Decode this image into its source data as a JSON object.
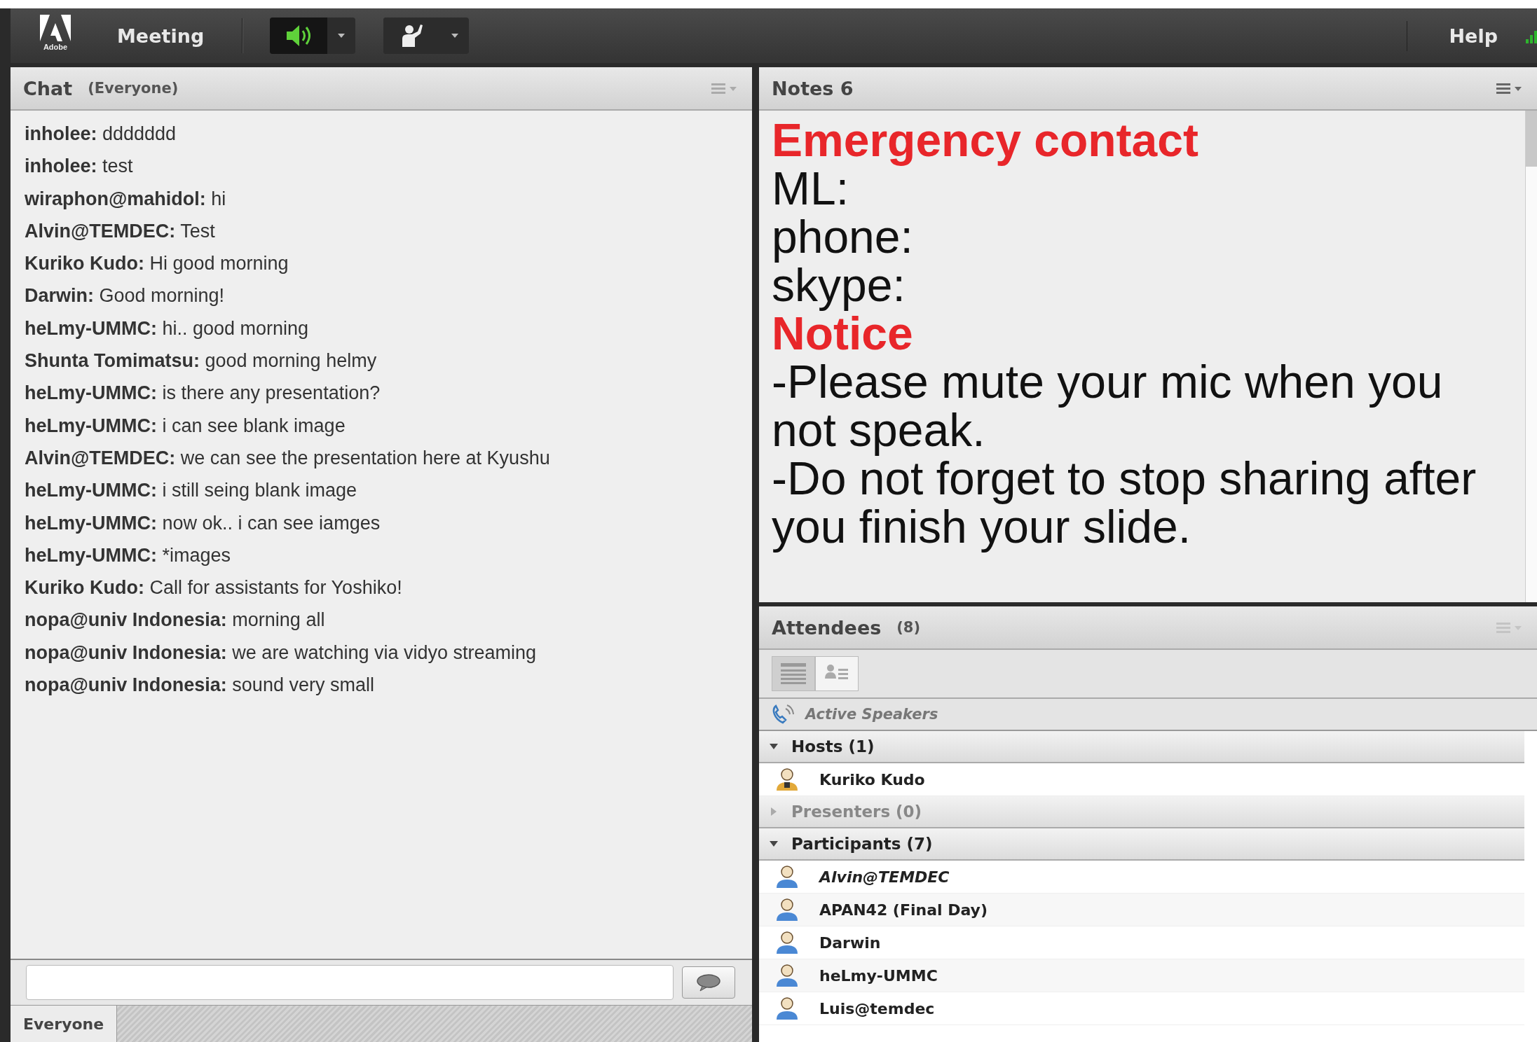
{
  "app_bar": {
    "logo_caption": "Adobe",
    "menu": "Meeting",
    "speaker_on": true,
    "help": "Help"
  },
  "chat": {
    "title": "Chat",
    "scope": "(Everyone)",
    "messages": [
      {
        "sender": "inholee:",
        "text": "ddddddd"
      },
      {
        "sender": "inholee:",
        "text": "test"
      },
      {
        "sender": "wiraphon@mahidol:",
        "text": "hi"
      },
      {
        "sender": "Alvin@TEMDEC:",
        "text": "Test"
      },
      {
        "sender": "Kuriko Kudo:",
        "text": "Hi good morning"
      },
      {
        "sender": "Darwin:",
        "text": "Good morning!"
      },
      {
        "sender": "heLmy-UMMC:",
        "text": "hi.. good morning"
      },
      {
        "sender": "Shunta Tomimatsu:",
        "text": "good morning helmy"
      },
      {
        "sender": "heLmy-UMMC:",
        "text": "is there any presentation?"
      },
      {
        "sender": "heLmy-UMMC:",
        "text": "i can see blank image"
      },
      {
        "sender": "Alvin@TEMDEC:",
        "text": "we can see the presentation here at Kyushu"
      },
      {
        "sender": "heLmy-UMMC:",
        "text": "i still seing blank image"
      },
      {
        "sender": "heLmy-UMMC:",
        "text": "now ok.. i can see iamges"
      },
      {
        "sender": "heLmy-UMMC:",
        "text": "*images"
      },
      {
        "sender": "Kuriko Kudo:",
        "text": "Call for assistants for Yoshiko!"
      },
      {
        "sender": "nopa@univ Indonesia:",
        "text": "morning all"
      },
      {
        "sender": "nopa@univ Indonesia:",
        "text": "we are watching via vidyo streaming"
      },
      {
        "sender": "nopa@univ Indonesia:",
        "text": "sound very small"
      }
    ],
    "recipient_tab": "Everyone"
  },
  "notes": {
    "title": "Notes 6",
    "lines": [
      {
        "kind": "heading",
        "text": "Emergency contact"
      },
      {
        "kind": "body",
        "text": "ML:"
      },
      {
        "kind": "body",
        "text": "phone:"
      },
      {
        "kind": "body",
        "text": "skype:"
      },
      {
        "kind": "heading",
        "text": "Notice"
      },
      {
        "kind": "body",
        "text": "-Please mute your mic when you not speak."
      },
      {
        "kind": "body",
        "text": "-Do not forget to stop sharing after you finish your slide."
      }
    ]
  },
  "attendees": {
    "title": "Attendees",
    "count": "(8)",
    "views": [
      {
        "kind": "list",
        "selected": true
      },
      {
        "kind": "cards",
        "selected": false
      }
    ],
    "active_speakers": "Active Speakers",
    "groups": [
      {
        "label": "Hosts (1)",
        "expanded": true,
        "empty": false,
        "people": [
          {
            "name": "Kuriko Kudo",
            "kind": "host",
            "italic": false
          }
        ]
      },
      {
        "label": "Presenters (0)",
        "expanded": false,
        "empty": true
      },
      {
        "label": "Participants (7)",
        "expanded": true,
        "empty": false,
        "people": [
          {
            "name": "Alvin@TEMDEC",
            "kind": "participant",
            "italic": true
          },
          {
            "name": "APAN42 (Final Day)",
            "kind": "participant",
            "italic": false
          },
          {
            "name": "Darwin",
            "kind": "participant",
            "italic": false
          },
          {
            "name": "heLmy-UMMC",
            "kind": "participant",
            "italic": false
          },
          {
            "name": "Luis@temdec",
            "kind": "participant",
            "italic": false
          }
        ]
      }
    ]
  }
}
